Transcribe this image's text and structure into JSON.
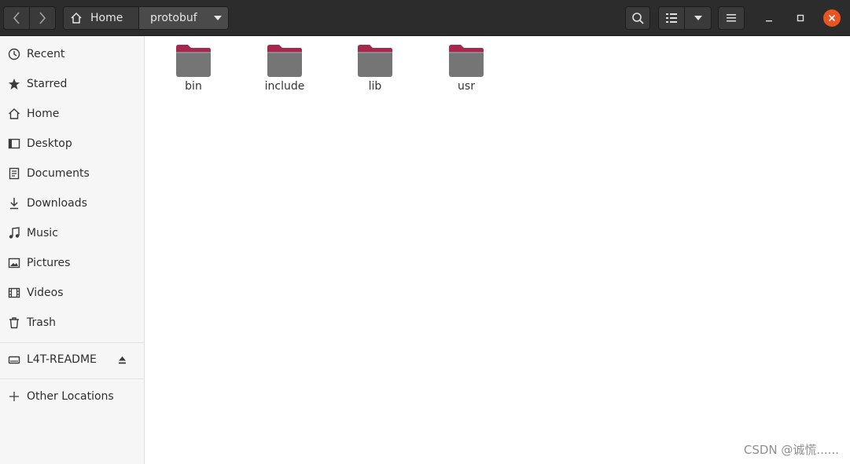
{
  "path": {
    "home_label": "Home",
    "current_label": "protobuf"
  },
  "sidebar": {
    "items": [
      {
        "label": "Recent",
        "icon": "clock-icon"
      },
      {
        "label": "Starred",
        "icon": "star-icon"
      },
      {
        "label": "Home",
        "icon": "home-icon"
      },
      {
        "label": "Desktop",
        "icon": "desktop-icon"
      },
      {
        "label": "Documents",
        "icon": "document-icon"
      },
      {
        "label": "Downloads",
        "icon": "download-icon"
      },
      {
        "label": "Music",
        "icon": "music-icon"
      },
      {
        "label": "Pictures",
        "icon": "picture-icon"
      },
      {
        "label": "Videos",
        "icon": "video-icon"
      },
      {
        "label": "Trash",
        "icon": "trash-icon"
      }
    ],
    "devices": [
      {
        "label": "L4T-README",
        "icon": "drive-icon"
      }
    ],
    "other_locations": "Other Locations"
  },
  "files": [
    {
      "name": "bin",
      "icon": "folder-icon"
    },
    {
      "name": "include",
      "icon": "folder-icon"
    },
    {
      "name": "lib",
      "icon": "folder-icon"
    },
    {
      "name": "usr",
      "icon": "folder-icon"
    }
  ],
  "watermark": "CSDN @诚慌......",
  "colors": {
    "headerbar": "#2c2c2c",
    "close_button": "#e95420",
    "folder_tab": "#a6284a",
    "folder_body": "#757575",
    "sidebar": "#f6f6f6"
  }
}
